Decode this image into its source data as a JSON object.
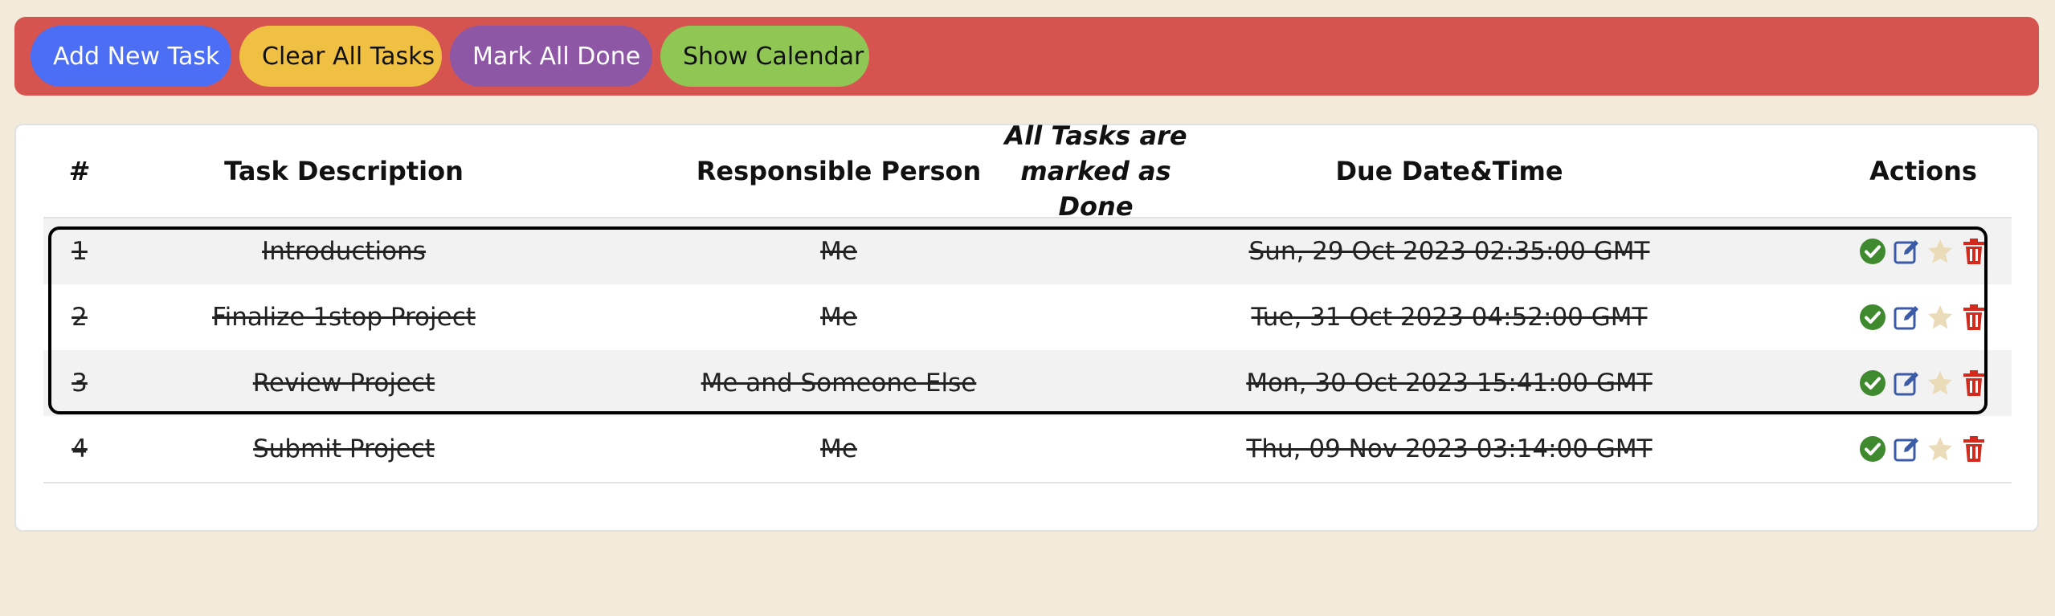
{
  "toolbar": {
    "add_label": "Add New Task",
    "clear_label": "Clear All Tasks",
    "mark_done_label": "Mark All Done",
    "calendar_label": "Show Calendar"
  },
  "table": {
    "headers": {
      "num": "#",
      "description": "Task Description",
      "person": "Responsible Person",
      "status_line1": "All Tasks are",
      "status_line2": "marked as Done",
      "due": "Due Date&Time",
      "actions": "Actions"
    },
    "rows": [
      {
        "num": "1",
        "description": "Introductions",
        "person": "Me",
        "due": "Sun, 29 Oct 2023 02:35:00 GMT",
        "done": true
      },
      {
        "num": "2",
        "description": "Finalize 1stop Project",
        "person": "Me",
        "due": "Tue, 31 Oct 2023 04:52:00 GMT",
        "done": true
      },
      {
        "num": "3",
        "description": "Review Project",
        "person": "Me and Someone Else",
        "due": "Mon, 30 Oct 2023 15:41:00 GMT",
        "done": true
      },
      {
        "num": "4",
        "description": "Submit Project",
        "person": "Me",
        "due": "Thu, 09 Nov 2023 03:14:00 GMT",
        "done": true
      }
    ],
    "row_actions": [
      "check-icon",
      "edit-icon",
      "star-icon",
      "trash-icon"
    ]
  },
  "colors": {
    "page_bg": "#f4ead9",
    "toolbar_bg": "#d6544f",
    "add_btn": "#4c6ef5",
    "clear_btn": "#f0c043",
    "mark_done_btn": "#8e57a6",
    "calendar_btn": "#8fc654",
    "check": "#3f8a2e",
    "edit": "#3b5aa8",
    "star": "#eadcb8",
    "trash": "#d32a1e"
  }
}
